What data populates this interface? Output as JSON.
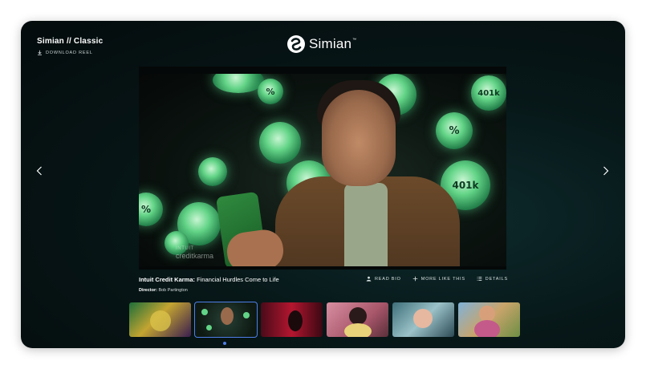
{
  "header": {
    "title": "Simian // Classic",
    "download_label": "DOWNLOAD REEL",
    "logo_text": "Simian",
    "logo_tm": "™"
  },
  "player": {
    "watermark_brand": "INTUIT",
    "watermark_product": "creditkarma",
    "bubbles": [
      "%",
      "401k",
      "%",
      "401k",
      "%"
    ]
  },
  "caption": {
    "client": "Intuit Credit Karma:",
    "title": " Financial Hurdles Come to Life",
    "director_label": "Director:",
    "director_name": " Bob Partington"
  },
  "actions": {
    "read_bio": "READ BIO",
    "more_like_this": "MORE LIKE THIS",
    "details": "DETAILS"
  },
  "thumbnails": {
    "active_index": 1,
    "count": 6
  },
  "colors": {
    "accent": "#4f7fe8",
    "background": "#071718",
    "bubble": "#63d487"
  }
}
